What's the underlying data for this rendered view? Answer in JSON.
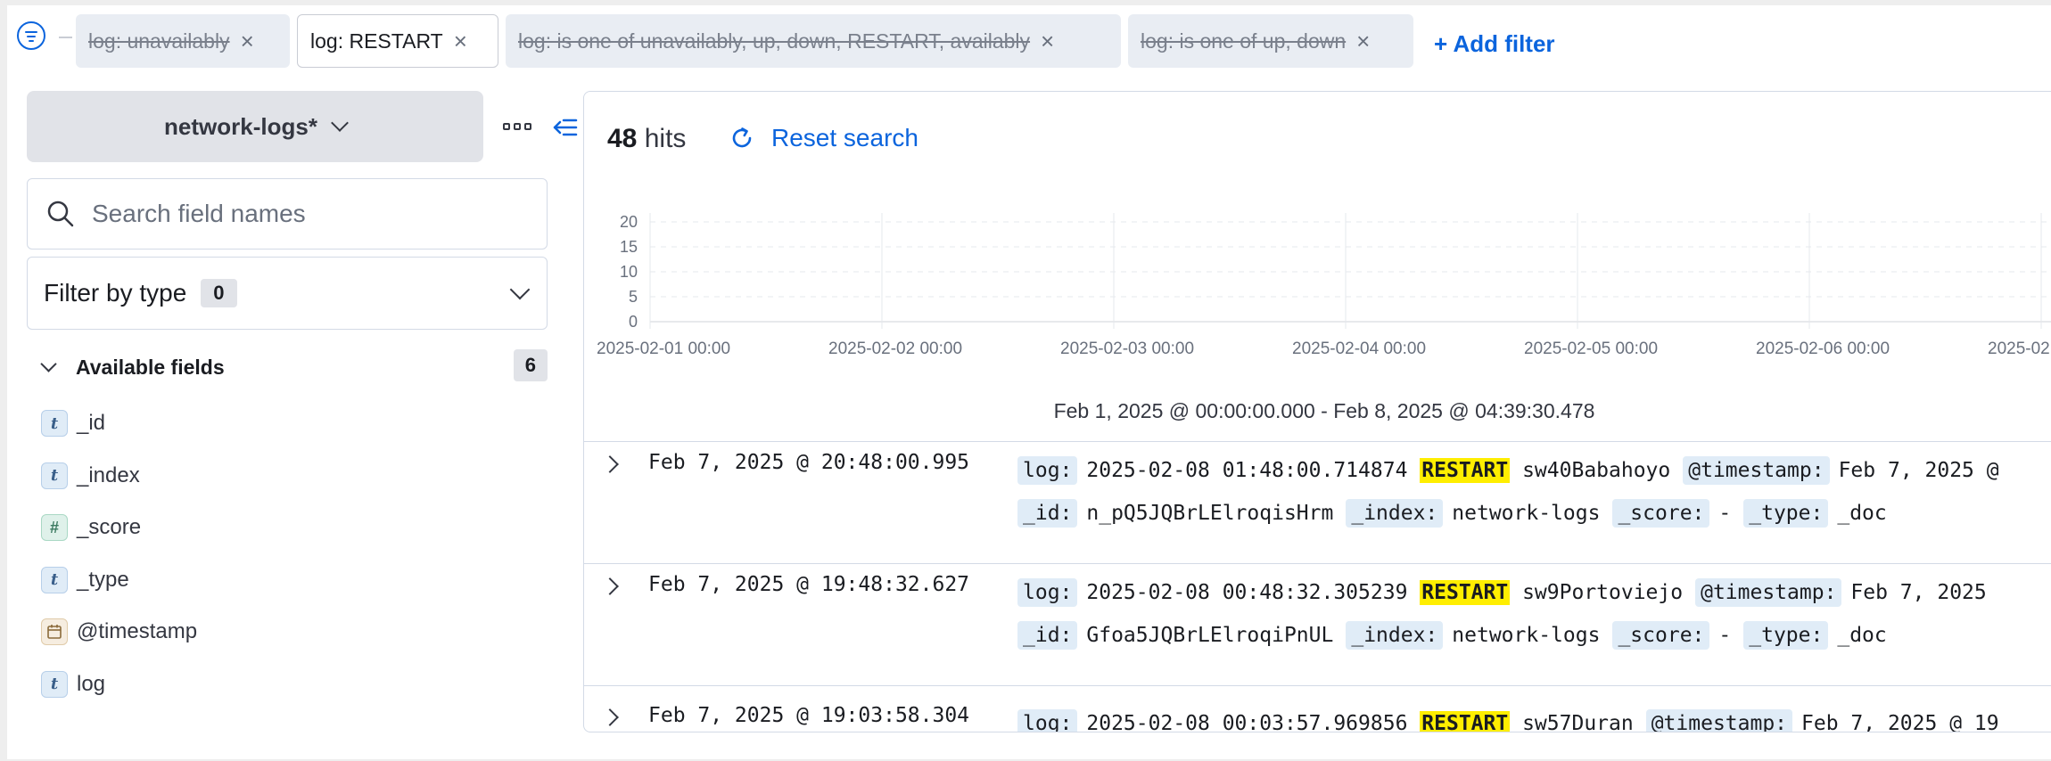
{
  "filters": [
    {
      "label": "log: unavailably",
      "disabled": true
    },
    {
      "label": "log: RESTART",
      "disabled": false
    },
    {
      "label": "log: is one of unavailably, up, down, RESTART, availably",
      "disabled": true
    },
    {
      "label": "log: is one of up, down",
      "disabled": true
    }
  ],
  "add_filter_label": "+ Add filter",
  "sidebar": {
    "index_pattern": "network-logs*",
    "search_placeholder": "Search field names",
    "filter_by_type_label": "Filter by type",
    "filter_by_type_count": "0",
    "available_fields_label": "Available fields",
    "available_fields_count": "6",
    "fields": [
      {
        "type": "t",
        "name": "_id"
      },
      {
        "type": "t",
        "name": "_index"
      },
      {
        "type": "#",
        "name": "_score"
      },
      {
        "type": "t",
        "name": "_type"
      },
      {
        "type": "date",
        "name": "@timestamp"
      },
      {
        "type": "t",
        "name": "log"
      }
    ]
  },
  "main": {
    "hits_count": "48",
    "hits_label": "hits",
    "reset_label": "Reset search",
    "time_range": "Feb 1, 2025 @ 00:00:00.000 - Feb 8, 2025 @ 04:39:30.478"
  },
  "chart_data": {
    "type": "bar",
    "categories": [
      "2025-02-01 00:00",
      "2025-02-02 00:00",
      "2025-02-03 00:00",
      "2025-02-04 00:00",
      "2025-02-05 00:00",
      "2025-02-06 00:00",
      "2025-02"
    ],
    "values": [],
    "yticks": [
      "20",
      "15",
      "10",
      "5",
      "0"
    ],
    "ylim": [
      0,
      20
    ],
    "grid": true
  },
  "rows": [
    {
      "time": "Feb 7, 2025 @ 20:48:00.995",
      "log_pre": "2025-02-08 01:48:00.714874",
      "log_hl": "RESTART",
      "log_post": "sw40Babahoyo",
      "timestamp_val": "Feb 7, 2025 @",
      "id": "n_pQ5JQBrLElroqisHrm",
      "index": "network-logs",
      "score": "-",
      "type": "_doc"
    },
    {
      "time": "Feb 7, 2025 @ 19:48:32.627",
      "log_pre": "2025-02-08 00:48:32.305239",
      "log_hl": "RESTART",
      "log_post": "sw9Portoviejo",
      "timestamp_val": "Feb 7, 2025",
      "id": "Gfoa5JQBrLElroqiPnUL",
      "index": "network-logs",
      "score": "-",
      "type": "_doc"
    },
    {
      "time": "Feb 7, 2025 @ 19:03:58.304",
      "log_pre": "2025-02-08 00:03:57.969856",
      "log_hl": "RESTART",
      "log_post": "sw57Duran",
      "timestamp_val": "Feb 7, 2025 @ 19"
    }
  ],
  "keys": {
    "log": "log:",
    "timestamp": "@timestamp:",
    "id": "_id:",
    "index": "_index:",
    "score": "_score:",
    "type": "_type:"
  }
}
